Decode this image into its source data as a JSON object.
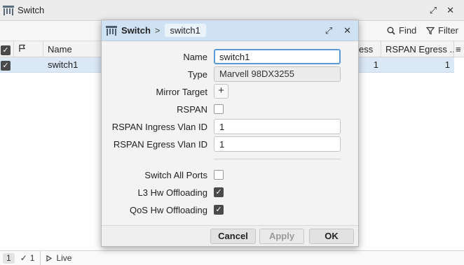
{
  "window": {
    "title": "Switch",
    "icons": {
      "app": "switch-icon",
      "restore": "restore-icon",
      "close": "close-icon"
    }
  },
  "toolbar": {
    "find_label": "Find",
    "filter_label": "Filter"
  },
  "table": {
    "headers": {
      "name": "Name",
      "rspan_ingress": "ess",
      "rspan_egress": "RSPAN Egress ..."
    },
    "rows": [
      {
        "name": "switch1",
        "rspan_ingress": "1",
        "rspan_egress": "1"
      }
    ]
  },
  "statusbar": {
    "total_count": "1",
    "selected_count": "1",
    "live_label": "Live"
  },
  "dialog": {
    "title": "Switch",
    "separator": ">",
    "breadcrumb": "switch1",
    "fields": {
      "name_label": "Name",
      "name_value": "switch1",
      "type_label": "Type",
      "type_value": "Marvell 98DX3255",
      "mirror_target_label": "Mirror Target",
      "rspan_label": "RSPAN",
      "rspan_ingress_label": "RSPAN Ingress Vlan ID",
      "rspan_ingress_value": "1",
      "rspan_egress_label": "RSPAN Egress Vlan ID",
      "rspan_egress_value": "1",
      "switch_all_ports_label": "Switch All Ports",
      "l3_hw_label": "L3 Hw Offloading",
      "qos_hw_label": "QoS Hw Offloading"
    },
    "checks": {
      "rspan": false,
      "switch_all_ports": false,
      "l3_hw": true,
      "qos_hw": true
    },
    "buttons": {
      "cancel": "Cancel",
      "apply": "Apply",
      "ok": "OK"
    }
  },
  "colors": {
    "dialog_titlebar": "#cfe2f3",
    "selected_row": "#dbe9f7",
    "focus_ring": "#5b9bd5"
  }
}
